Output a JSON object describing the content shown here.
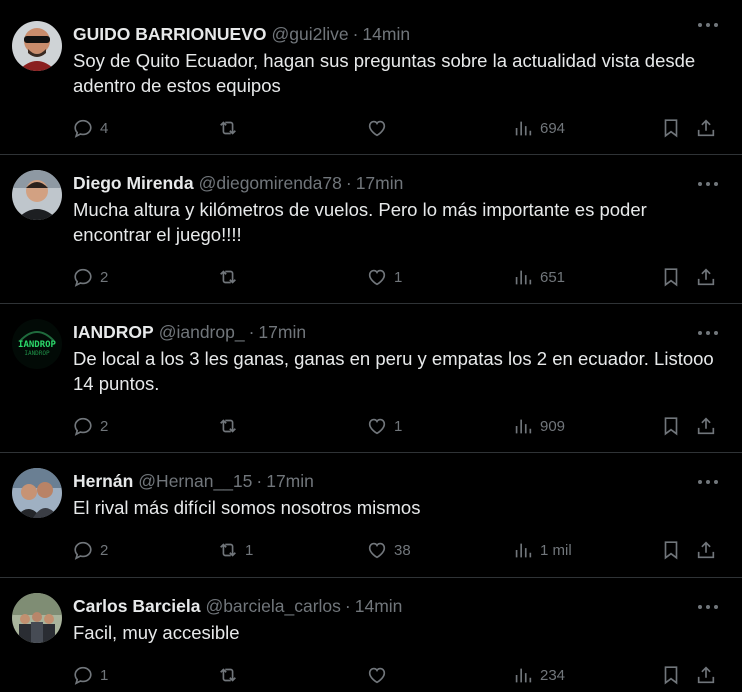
{
  "tweets": [
    {
      "name": "GUIDO BARRIONUEVO",
      "handle": "@gui2live",
      "separator": "·",
      "time": "14min",
      "text": "Soy de Quito Ecuador, hagan sus preguntas sobre la actualidad vista desde adentro de estos equipos",
      "replies": "4",
      "retweets": "",
      "likes": "",
      "views": "694",
      "avatar": "avatar-sunglasses-man"
    },
    {
      "name": "Diego Mirenda",
      "handle": "@diegomirenda78",
      "separator": "·",
      "time": "17min",
      "text": "Mucha altura y kilómetros de vuelos. Pero lo más importante es poder encontrar el juego!!!!",
      "replies": "2",
      "retweets": "",
      "likes": "1",
      "views": "651",
      "avatar": "avatar-man-dark-shirt"
    },
    {
      "name": "IANDROP",
      "handle": "@iandrop_",
      "separator": "·",
      "time": "17min",
      "text": "De local a los 3 les ganas, ganas en peru y empatas los 2 en ecuador. Listooo 14 puntos.",
      "replies": "2",
      "retweets": "",
      "likes": "1",
      "views": "909",
      "avatar": "avatar-iandrop-logo",
      "avatar_text": "IANDROP"
    },
    {
      "name": "Hernán",
      "handle": "@Hernan__15",
      "separator": "·",
      "time": "17min",
      "text": "El rival más difícil somos nosotros mismos",
      "replies": "2",
      "retweets": "1",
      "likes": "38",
      "views": "1 mil",
      "avatar": "avatar-two-people"
    },
    {
      "name": "Carlos Barciela",
      "handle": "@barciela_carlos",
      "separator": "·",
      "time": "14min",
      "text": "Facil, muy accesible",
      "replies": "1",
      "retweets": "",
      "likes": "",
      "views": "234",
      "avatar": "avatar-group-photo"
    }
  ],
  "colors": {
    "background": "#000000",
    "text": "#e7e9ea",
    "muted": "#71767b",
    "divider": "#2f3336",
    "logo_green": "#2bd86a"
  },
  "icons": [
    "reply-icon",
    "retweet-icon",
    "like-icon",
    "views-icon",
    "bookmark-icon",
    "share-icon",
    "more-icon"
  ]
}
